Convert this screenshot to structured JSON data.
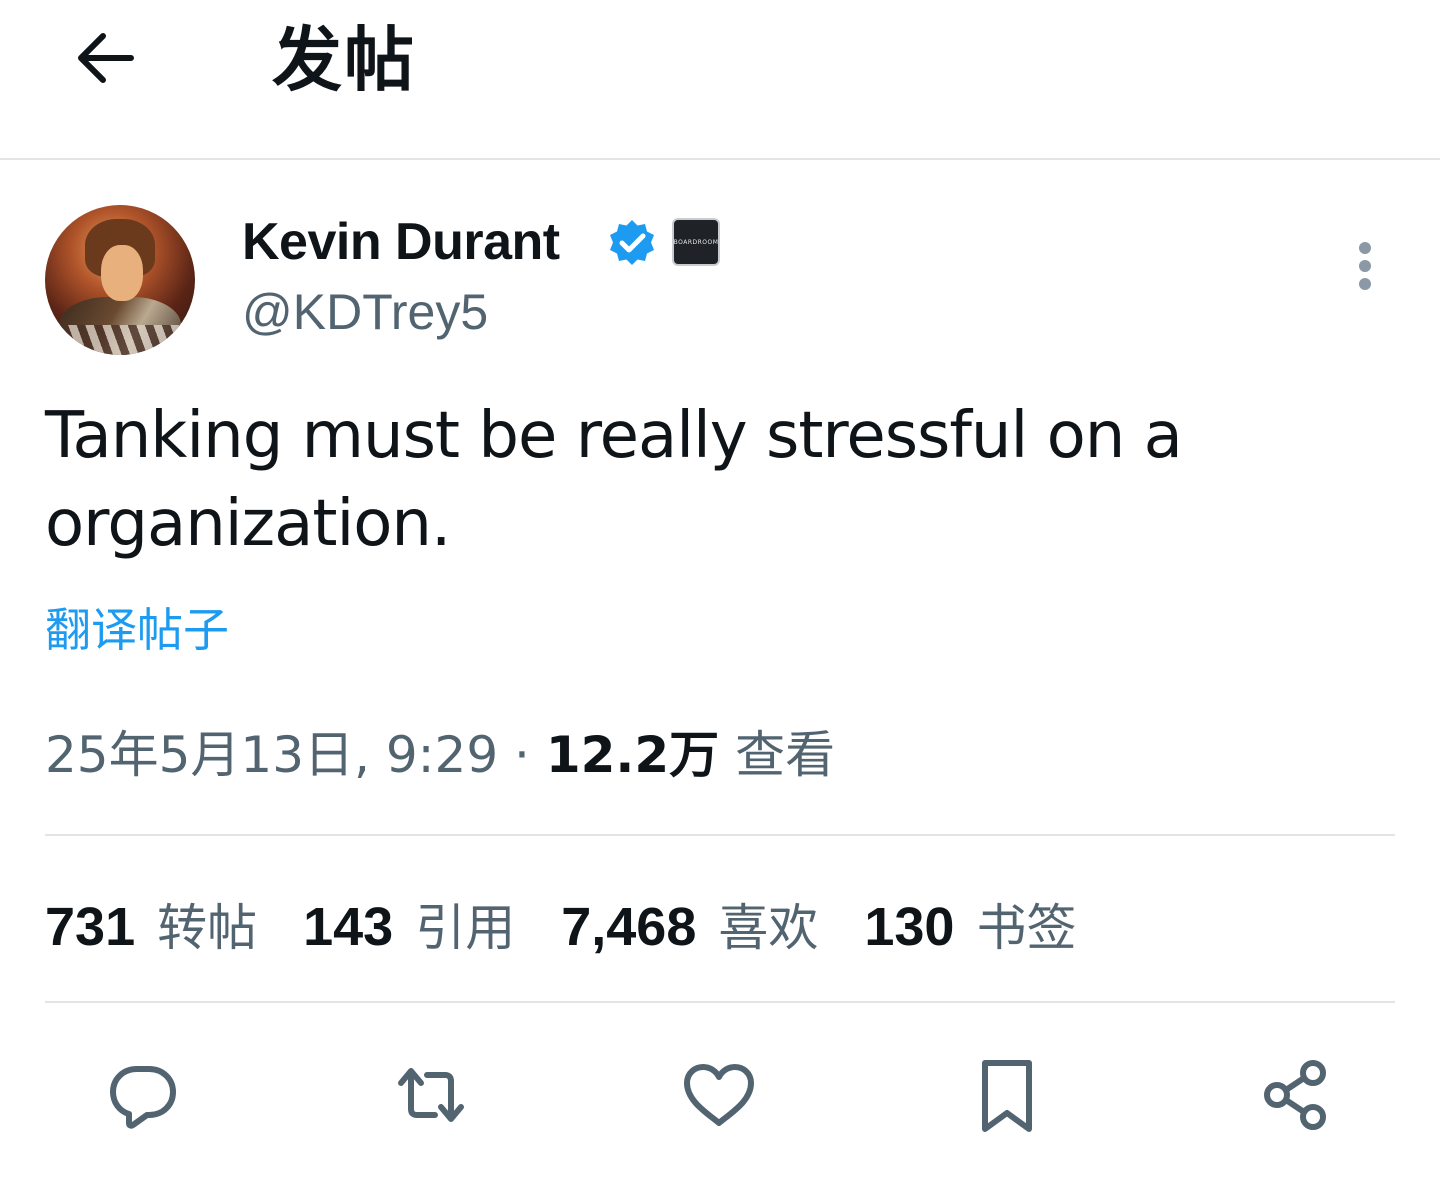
{
  "header": {
    "title": "发帖",
    "back_icon": "arrow-left-icon"
  },
  "author": {
    "name": "Kevin Durant",
    "handle": "@KDTrey5",
    "verified_color": "#1d9bf0",
    "affiliate_badge_text": "BOARDROOM"
  },
  "post": {
    "text": "Tanking must be really stressful on a organization.",
    "translate_label": "翻译帖子",
    "timestamp": "25年5月13日, 9:29",
    "separator": " · ",
    "views_count": "12.2万",
    "views_label": "查看"
  },
  "stats": [
    {
      "count": "731",
      "label": "转帖"
    },
    {
      "count": "143",
      "label": "引用"
    },
    {
      "count": "7,468",
      "label": "喜欢"
    },
    {
      "count": "130",
      "label": "书签"
    }
  ],
  "actions": [
    "reply-icon",
    "repost-icon",
    "like-icon",
    "bookmark-icon",
    "share-icon"
  ],
  "colors": {
    "text_primary": "#0f1419",
    "text_secondary": "#536471",
    "link": "#1d9bf0",
    "divider": "#e1e5e8"
  }
}
